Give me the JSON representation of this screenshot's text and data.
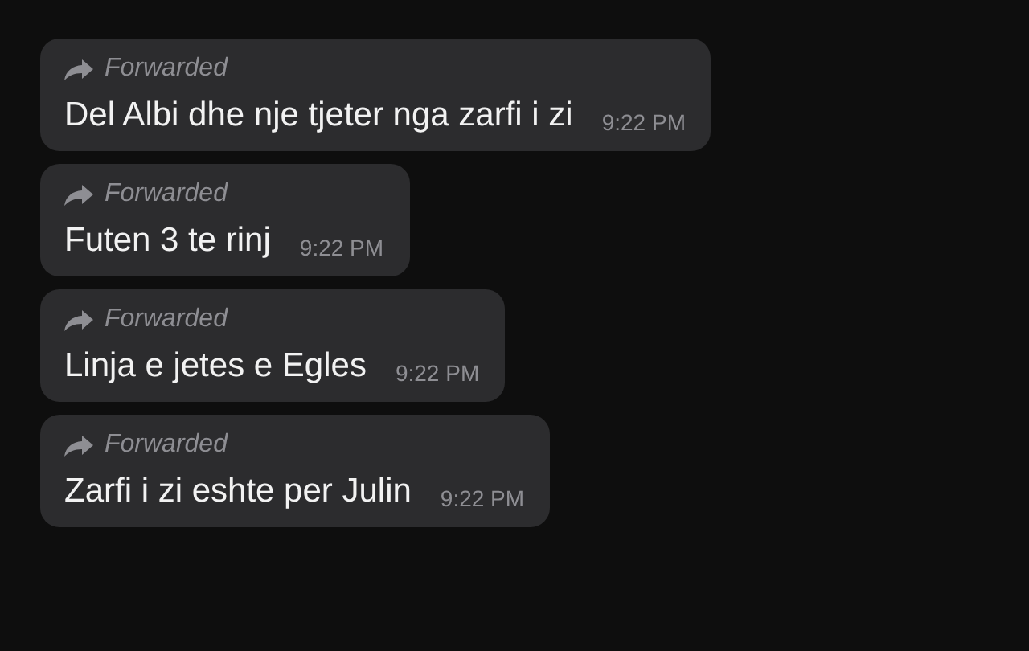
{
  "messages": [
    {
      "forwarded_label": "Forwarded",
      "text": "Del Albi dhe nje tjeter nga zarfi i zi",
      "time": "9:22 PM"
    },
    {
      "forwarded_label": "Forwarded",
      "text": "Futen 3 te rinj",
      "time": "9:22 PM"
    },
    {
      "forwarded_label": "Forwarded",
      "text": "Linja e jetes e Egles",
      "time": "9:22 PM"
    },
    {
      "forwarded_label": "Forwarded",
      "text": "Zarfi i zi eshte per Julin",
      "time": "9:22 PM"
    }
  ]
}
